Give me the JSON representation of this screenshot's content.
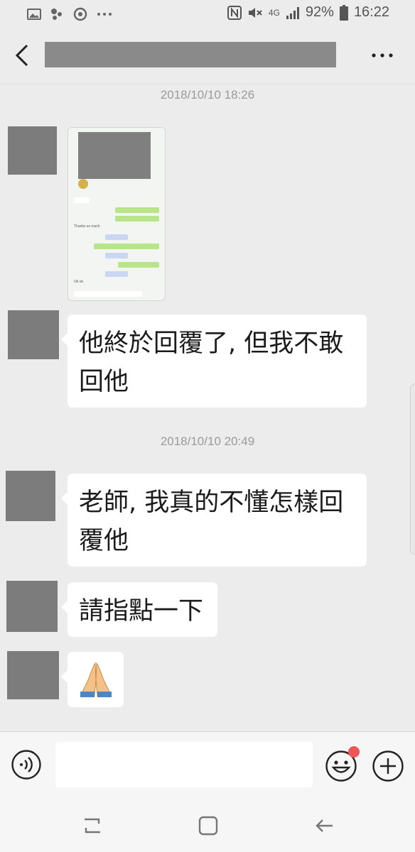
{
  "status_bar": {
    "network": "4G",
    "battery": "92%",
    "time": "16:22",
    "icons": [
      "gallery-icon",
      "notification-icon",
      "sync-icon",
      "more-dots-icon",
      "nfc-icon",
      "mute-icon",
      "signal-icon",
      "battery-icon"
    ]
  },
  "header": {
    "back_icon": "back-arrow-icon",
    "more_icon": "more-options-icon"
  },
  "messages": [
    {
      "type": "timestamp",
      "text": "2018/10/10 18:26"
    },
    {
      "type": "image",
      "content": "screenshot-thumbnail"
    },
    {
      "type": "text",
      "text": "他終於回覆了, 但我不敢回他"
    },
    {
      "type": "timestamp",
      "text": "2018/10/10 20:49"
    },
    {
      "type": "text",
      "text": "老師, 我真的不懂怎樣回覆他"
    },
    {
      "type": "text",
      "text": "請指點一下"
    },
    {
      "type": "emoji",
      "text": "🙏"
    }
  ],
  "thumbnail_text": {
    "line1": "Thanks so much",
    "line2": "Ok ok"
  },
  "input_bar": {
    "placeholder": "",
    "icons": [
      "voice-icon",
      "emoji-icon",
      "plus-icon"
    ]
  },
  "colors": {
    "background": "#ececec",
    "bubble": "#ffffff",
    "avatar_redaction": "#7c7c7c",
    "notification_dot": "#f25555"
  }
}
